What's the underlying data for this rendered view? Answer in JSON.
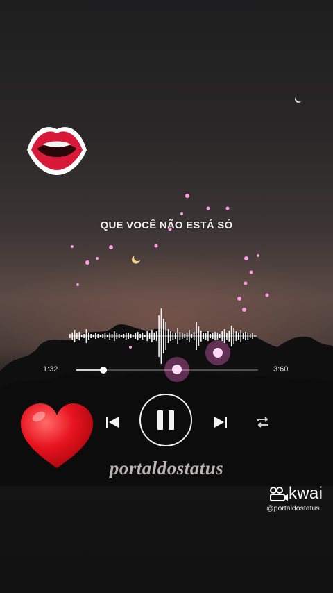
{
  "lyric": {
    "text": "QUE VOCÊ NÃO ESTÁ SÓ"
  },
  "player": {
    "current_time": "1:32",
    "total_time": "3:60",
    "progress_fraction": 0.15,
    "state": "playing"
  },
  "watermark": {
    "text": "portaldostatus"
  },
  "kwai": {
    "name": "kwai",
    "handle": "@portaldostatus"
  },
  "colors": {
    "sparkle_pink": "#ff9be6",
    "heart_red": "#e8141f",
    "lips_red": "#d8193a",
    "control_white": "#f1f1f1"
  },
  "icons": {
    "lips": "lips-icon",
    "heart": "heart-icon",
    "previous": "skip-previous-icon",
    "pause": "pause-icon",
    "next": "skip-next-icon",
    "repeat": "repeat-icon",
    "kwai_logo": "kwai-logo-icon"
  }
}
